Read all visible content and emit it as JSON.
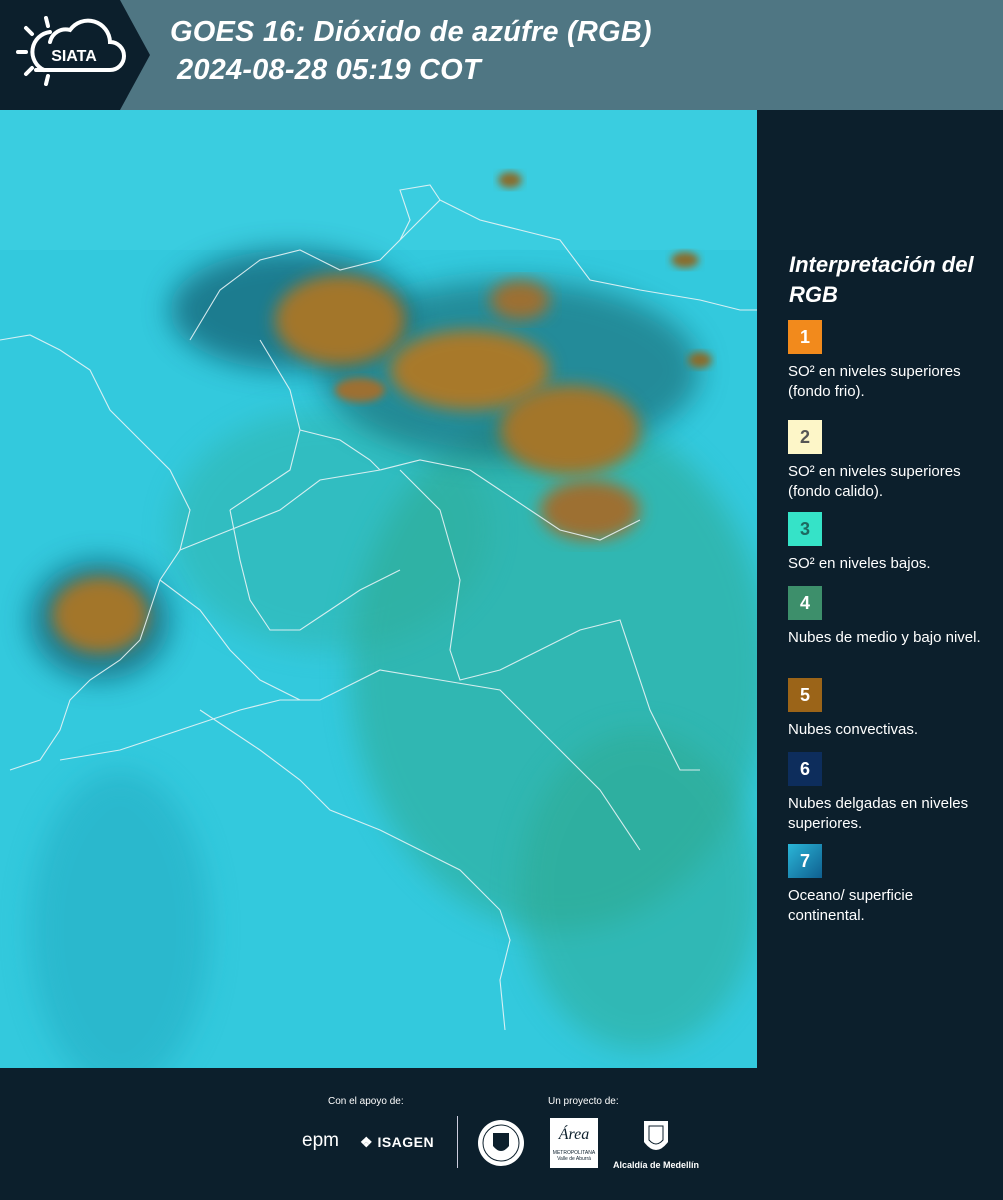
{
  "header": {
    "logo_text": "SIATA",
    "title_line1": "GOES 16: Dióxido de azúfre (RGB)",
    "title_line2": "2024-08-28 05:19 COT"
  },
  "legend": {
    "title": "Interpretación del RGB",
    "items": [
      {
        "number": "1",
        "label": "SO² en niveles superiores (fondo frio).",
        "color": "#f28a1c",
        "text_color": "#ffffff"
      },
      {
        "number": "2",
        "label": "SO² en niveles superiores (fondo calido).",
        "color": "#fdf6c8",
        "text_color": "#555555"
      },
      {
        "number": "3",
        "label": "SO² en niveles bajos.",
        "color": "#35e3c8",
        "text_color": "#1d6a60"
      },
      {
        "number": "4",
        "label": "Nubes de medio y bajo nivel.",
        "color": "#3d8f6b",
        "text_color": "#ffffff"
      },
      {
        "number": "5",
        "label": "Nubes convectivas.",
        "color": "#9b6418",
        "text_color": "#ffffff"
      },
      {
        "number": "6",
        "label": "Nubes delgadas en niveles superiores.",
        "color": "#0d2d5c",
        "text_color": "#ffffff"
      },
      {
        "number": "7",
        "label": "Oceano/ superficie continental.",
        "color": "#1b92c0",
        "text_color": "#ffffff"
      }
    ]
  },
  "footer": {
    "support_caption": "Con el apoyo de:",
    "project_caption": "Un proyecto de:",
    "epm_text": "epm",
    "isagen_text": "ISAGEN",
    "area_text": "Área",
    "area_subtext": "METROPOLITANA",
    "area_subtext2": "Valle de Aburrá",
    "alcaldia_text": "Alcaldía de Medellín"
  }
}
